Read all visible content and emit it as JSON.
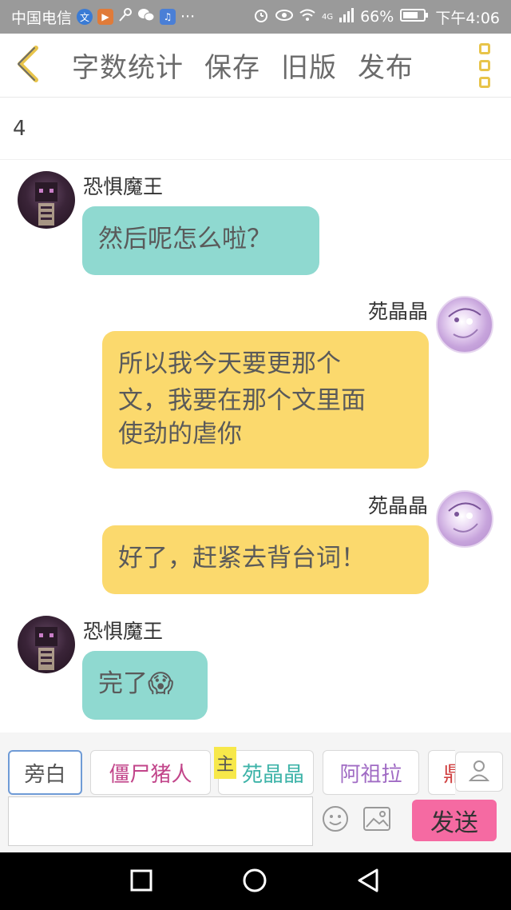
{
  "status_bar": {
    "carrier": "中国电信",
    "network": "4G",
    "battery": "66%",
    "time": "下午4:06",
    "more": "···"
  },
  "nav": {
    "word_count": "字数统计",
    "save": "保存",
    "old_version": "旧版",
    "publish": "发布"
  },
  "counter": "4",
  "messages": [
    {
      "sender": "恐惧魔王",
      "side": "left",
      "color": "#8fd9d0",
      "lines": [
        "然后呢怎么啦？"
      ]
    },
    {
      "sender": "苑晶晶",
      "side": "right",
      "color": "#fbd96d",
      "lines": [
        "所以我今天要更那个",
        "文，我要在那个文里面",
        "使劲的虐你"
      ]
    },
    {
      "sender": "苑晶晶",
      "side": "right",
      "color": "#fbd96d",
      "lines": [
        "好了，赶紧去背台词！"
      ]
    },
    {
      "sender": "恐惧魔王",
      "side": "left",
      "color": "#8fd9d0",
      "lines": [
        "完了😱"
      ]
    }
  ],
  "roles": [
    {
      "label": "旁白",
      "color": "#555555"
    },
    {
      "label": "僵尸猪人",
      "color": "#c2458a"
    },
    {
      "label": "苑晶晶",
      "color": "#3db3a8"
    },
    {
      "label": "阿祖拉",
      "color": "#a06bc4"
    },
    {
      "label": "鼎",
      "color": "#d04040"
    }
  ],
  "host_badge": "主",
  "input": {
    "value": "",
    "placeholder": ""
  },
  "send_label": "发送",
  "colors": {
    "accent": "#e8c44a",
    "teal_bubble": "#8fd9d0",
    "yellow_bubble": "#fbd96d",
    "send": "#f56aa2"
  }
}
